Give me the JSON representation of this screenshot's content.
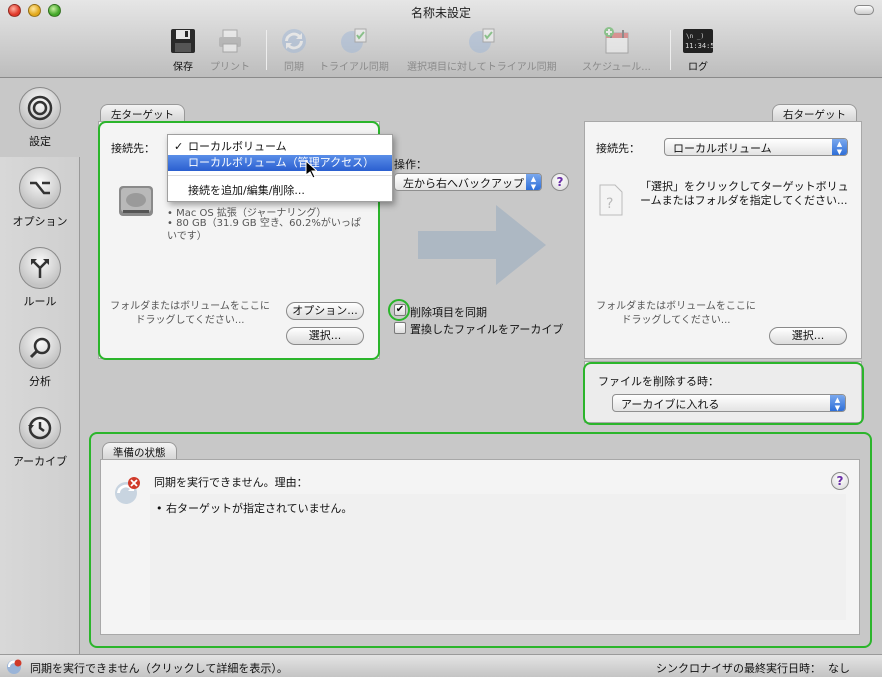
{
  "window": {
    "title": "名称未設定"
  },
  "toolbar": {
    "save": "保存",
    "print": "プリント",
    "sync": "同期",
    "trial_sync": "トライアル同期",
    "trial_selected": "選択項目に対してトライアル同期",
    "schedule": "スケジュール...",
    "log": "ログ",
    "log_screen_text": "11:34:5"
  },
  "sidebar": {
    "items": [
      {
        "label": "設定",
        "icon": "target-icon",
        "active": true
      },
      {
        "label": "オプション",
        "icon": "option-key-icon"
      },
      {
        "label": "ルール",
        "icon": "branch-arrows-icon"
      },
      {
        "label": "分析",
        "icon": "magnifier-icon"
      },
      {
        "label": "アーカイブ",
        "icon": "clock-history-icon"
      }
    ]
  },
  "left_target": {
    "tab": "左ターゲット",
    "connect_label": "接続先：",
    "menu": {
      "items": [
        "ローカルボリューム",
        "ローカルボリューム（管理アクセス）",
        "接続を追加/編集/削除..."
      ],
      "checked_index": 0,
      "highlighted_index": 1
    },
    "volume_info": [
      "Mac OS 拡張（ジャーナリング）",
      "80 GB（31.9 GB 空き、60.2%がいっぱいです）"
    ],
    "drop_hint": "フォルダまたはボリュームをここにドラッグしてください...",
    "options_button": "オプション...",
    "select_button": "選択..."
  },
  "operation": {
    "label": "操作：",
    "value": "左から右へバックアップ",
    "sync_deletions": "削除項目を同期",
    "sync_deletions_checked": true,
    "archive_replaced": "置換したファイルをアーカイブ",
    "archive_replaced_checked": false
  },
  "right_target": {
    "tab": "右ターゲット",
    "connect_label": "接続先：",
    "connect_value": "ローカルボリューム",
    "instruction": "「選択」をクリックしてターゲットボリュームまたはフォルダを指定してください...",
    "drop_hint": "フォルダまたはボリュームをここにドラッグしてください...",
    "select_button": "選択..."
  },
  "delete_policy": {
    "label": "ファイルを削除する時：",
    "value": "アーカイブに入れる"
  },
  "status": {
    "tab": "準備の状態",
    "message": "同期を実行できません。理由：",
    "reasons": [
      "右ターゲットが指定されていません。"
    ]
  },
  "statusbar": {
    "left": "同期を実行できません（クリックして詳細を表示）。",
    "last_run_label": "シンクロナイザの最終実行日時：",
    "last_run_value": "なし"
  },
  "colors": {
    "highlight_box": "#2bb52b",
    "selection": "#2a5fd0",
    "help_purple": "#6a2fa8"
  }
}
